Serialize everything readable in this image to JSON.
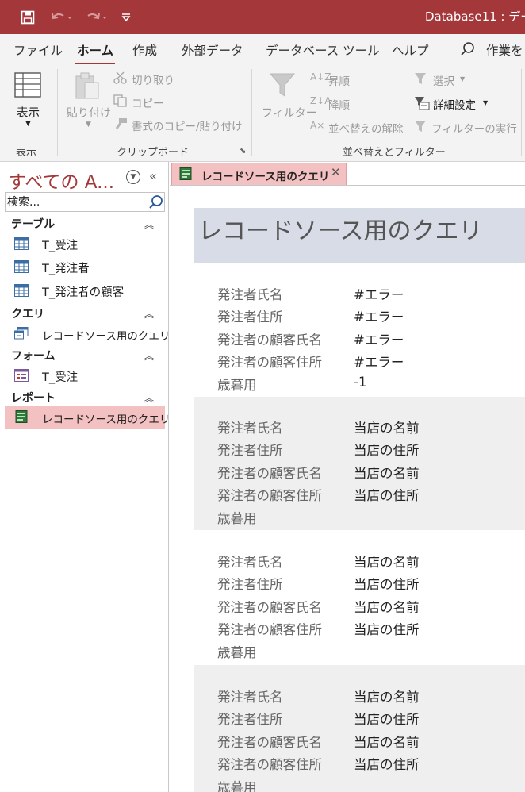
{
  "titlebar": {
    "title": "Database11 : デー",
    "bg_color": "#a4373a",
    "save_icon": "save-icon",
    "undo_icon": "undo-icon",
    "redo_icon": "redo-icon",
    "customize_icon": "customize-qat-icon"
  },
  "ribbon_tabs": {
    "file": "ファイル",
    "home": "ホーム",
    "create": "作成",
    "external": "外部データ",
    "dbtools": "データベース ツール",
    "help": "ヘルプ",
    "tellme": "作業を"
  },
  "ribbon": {
    "view_label": "表示",
    "paste_label": "貼り付け",
    "cut_label": "切り取り",
    "copy_label": "コピー",
    "format_painter_label": "書式のコピー/貼り付け",
    "filter_label": "フィルター",
    "ascending_label": "昇順",
    "descending_label": "降順",
    "remove_sort_label": "並べ替えの解除",
    "selection_label": "選択",
    "advanced_label": "詳細設定",
    "toggle_filter_label": "フィルターの実行",
    "group_view": "表示",
    "group_clipboard": "クリップボード",
    "group_sort_filter": "並べ替えとフィルター"
  },
  "nav": {
    "title": "すべての A...",
    "search_placeholder": "検索...",
    "sections": {
      "tables": "テーブル",
      "queries": "クエリ",
      "forms": "フォーム",
      "reports": "レポート"
    },
    "tables": [
      "T_受注",
      "T_発注者",
      "T_発注者の顧客"
    ],
    "queries": [
      "レコードソース用のクエリ"
    ],
    "forms": [
      "T_受注"
    ],
    "reports": [
      "レコードソース用のクエリ"
    ]
  },
  "document": {
    "tab_label": "レコードソース用のクエリ",
    "report_title": "レコードソース用のクエリ",
    "field_labels": [
      "発注者氏名",
      "発注者住所",
      "発注者の顧客氏名",
      "発注者の顧客住所",
      "歳暮用"
    ],
    "records": [
      {
        "values": [
          "#エラー",
          "#エラー",
          "#エラー",
          "#エラー",
          "-1"
        ]
      },
      {
        "values": [
          "当店の名前",
          "当店の住所",
          "当店の名前",
          "当店の住所",
          ""
        ]
      },
      {
        "values": [
          "当店の名前",
          "当店の住所",
          "当店の名前",
          "当店の住所",
          ""
        ]
      },
      {
        "values": [
          "当店の名前",
          "当店の住所",
          "当店の名前",
          "当店の住所",
          ""
        ]
      }
    ]
  }
}
